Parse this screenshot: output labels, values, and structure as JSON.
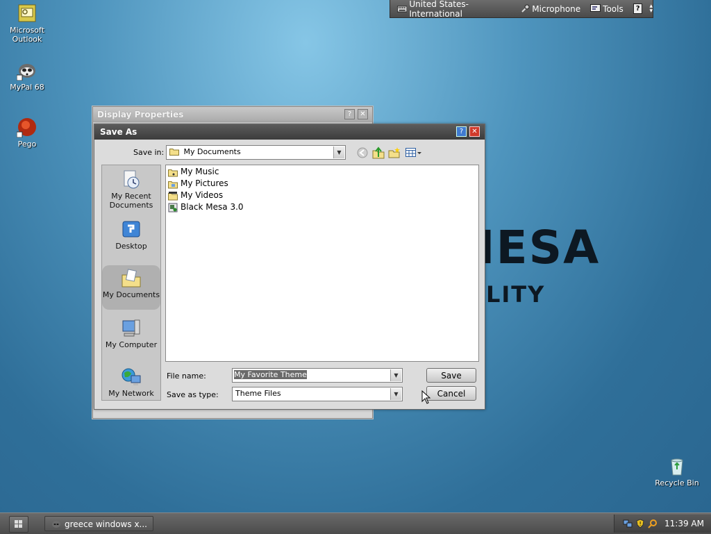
{
  "desktop": {
    "icons": [
      {
        "label_line1": "Microsoft",
        "label_line2": "Outlook",
        "icon": "outlook-icon"
      },
      {
        "label": "MyPal 68",
        "icon": "mypal-icon"
      },
      {
        "label": "Pego",
        "icon": "pego-icon"
      },
      {
        "label": "Recycle Bin",
        "icon": "recycle-bin-icon"
      }
    ],
    "wallpaper_text_large": "IESA",
    "wallpaper_text_small": "LITY"
  },
  "language_bar": {
    "language": "United States-International",
    "microphone": "Microphone",
    "tools": "Tools"
  },
  "display_properties": {
    "title": "Display Properties"
  },
  "save_as": {
    "title": "Save As",
    "save_in_label": "Save in:",
    "save_in_value": "My Documents",
    "places": [
      {
        "label_line1": "My Recent",
        "label_line2": "Documents"
      },
      {
        "label": "Desktop"
      },
      {
        "label": "My Documents"
      },
      {
        "label": "My Computer"
      },
      {
        "label": "My Network"
      }
    ],
    "files": [
      "My Music",
      "My Pictures",
      "My Videos",
      "Black Mesa 3.0"
    ],
    "file_name_label": "File name:",
    "file_name_value": "My Favorite Theme",
    "save_as_type_label": "Save as type:",
    "save_as_type_value": "Theme Files",
    "save_button": "Save",
    "cancel_button": "Cancel"
  },
  "taskbar": {
    "task_item": "greece windows x...",
    "clock": "11:39 AM"
  }
}
